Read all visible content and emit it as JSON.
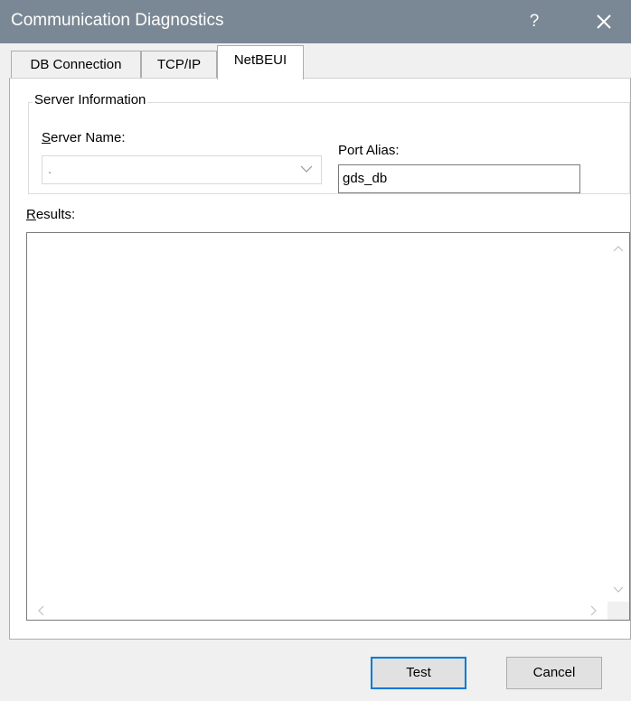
{
  "window": {
    "title": "Communication Diagnostics",
    "help_label": "?",
    "close_icon": "close-icon",
    "titlebar_color": "#7a8895"
  },
  "tabs": [
    {
      "label": "DB Connection",
      "selected": false
    },
    {
      "label": "TCP/IP",
      "selected": false
    },
    {
      "label": "NetBEUI",
      "selected": true
    }
  ],
  "server_info": {
    "legend": "Server Information",
    "server_name_label_access": "S",
    "server_name_label_rest": "erver Name:",
    "server_name_value": ".",
    "port_alias_label": "Port Alias:",
    "port_alias_value": "gds_db"
  },
  "results": {
    "label_access": "R",
    "label_rest": "esults:",
    "content": ""
  },
  "buttons": {
    "test": "Test",
    "cancel": "Cancel"
  },
  "colors": {
    "focus_border": "#0078d7",
    "dialog_bg": "#f0f0f0"
  }
}
